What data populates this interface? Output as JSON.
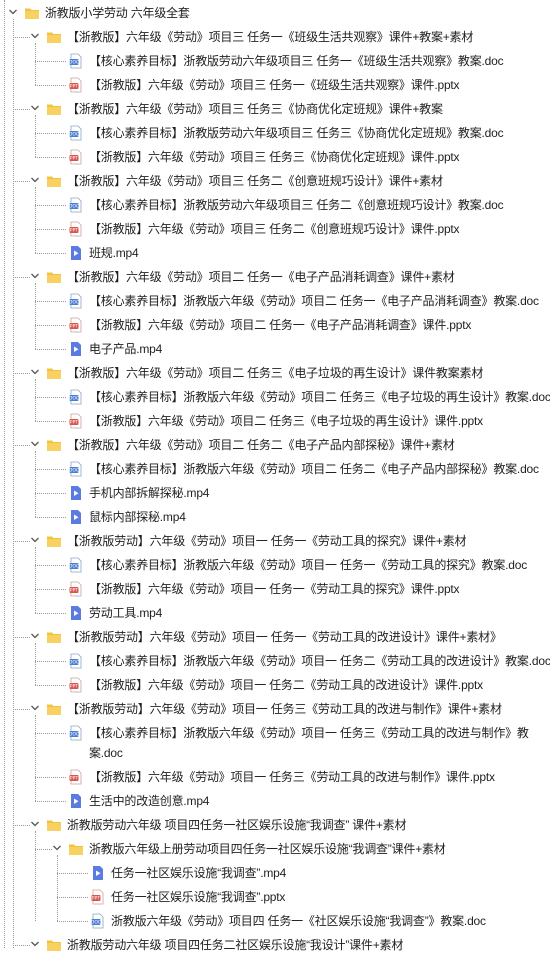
{
  "colors": {
    "folder": "#f2c23b",
    "doc": "#4a7fd1",
    "pptx": "#d9534f",
    "mp4": "#5b7be0",
    "guide": "#9a9a9a"
  },
  "tree": [
    {
      "depth": 0,
      "type": "folder",
      "expander": true,
      "label": "浙教版小学劳动 六年级全套"
    },
    {
      "depth": 1,
      "type": "folder",
      "expander": true,
      "label": "【浙教版】六年级《劳动》项目三 任务一《班级生活共观察》课件+教案+素材"
    },
    {
      "depth": 2,
      "type": "doc",
      "expander": false,
      "label": "【核心素养目标】浙教版劳动六年级项目三 任务一《班级生活共观察》教案.doc"
    },
    {
      "depth": 2,
      "type": "pptx",
      "expander": false,
      "label": "【浙教版】六年级《劳动》项目三 任务一《班级生活共观察》课件.pptx"
    },
    {
      "depth": 1,
      "type": "folder",
      "expander": true,
      "label": "【浙教版】六年级《劳动》项目三 任务三《协商优化定班规》课件+教案"
    },
    {
      "depth": 2,
      "type": "doc",
      "expander": false,
      "label": "【核心素养目标】浙教版劳动六年级项目三 任务三《协商优化定班规》教案.doc"
    },
    {
      "depth": 2,
      "type": "pptx",
      "expander": false,
      "label": "【浙教版】六年级《劳动》项目三 任务三《协商优化定班规》课件.pptx"
    },
    {
      "depth": 1,
      "type": "folder",
      "expander": true,
      "label": "【浙教版】六年级《劳动》项目三 任务二《创意班规巧设计》课件+素材"
    },
    {
      "depth": 2,
      "type": "doc",
      "expander": false,
      "label": "【核心素养目标】浙教版劳动六年级项目三 任务二《创意班规巧设计》教案.doc"
    },
    {
      "depth": 2,
      "type": "pptx",
      "expander": false,
      "label": "【浙教版】六年级《劳动》项目三 任务二《创意班规巧设计》课件.pptx"
    },
    {
      "depth": 2,
      "type": "mp4",
      "expander": false,
      "label": "班规.mp4"
    },
    {
      "depth": 1,
      "type": "folder",
      "expander": true,
      "label": "【浙教版】六年级《劳动》项目二 任务一《电子产品消耗调查》课件+素材"
    },
    {
      "depth": 2,
      "type": "doc",
      "expander": false,
      "label": "【核心素养目标】浙教版六年级《劳动》项目二 任务一《电子产品消耗调查》教案.doc"
    },
    {
      "depth": 2,
      "type": "pptx",
      "expander": false,
      "label": "【浙教版】六年级《劳动》项目二 任务一《电子产品消耗调查》课件.pptx"
    },
    {
      "depth": 2,
      "type": "mp4",
      "expander": false,
      "label": "电子产品.mp4"
    },
    {
      "depth": 1,
      "type": "folder",
      "expander": true,
      "label": "【浙教版】六年级《劳动》项目二 任务三《电子垃圾的再生设计》课件教案素材"
    },
    {
      "depth": 2,
      "type": "doc",
      "expander": false,
      "label": "【核心素养目标】浙教版六年级《劳动》项目二 任务三《电子垃圾的再生设计》教案.doc"
    },
    {
      "depth": 2,
      "type": "pptx",
      "expander": false,
      "label": "【浙教版】六年级《劳动》项目二 任务三《电子垃圾的再生设计》课件.pptx"
    },
    {
      "depth": 1,
      "type": "folder",
      "expander": true,
      "label": "【浙教版】六年级《劳动》项目二 任务二《电子产品内部探秘》课件+素材"
    },
    {
      "depth": 2,
      "type": "doc",
      "expander": false,
      "label": "【核心素养目标】浙教版六年级《劳动》项目二 任务二《电子产品内部探秘》教案.doc"
    },
    {
      "depth": 2,
      "type": "mp4",
      "expander": false,
      "label": "手机内部拆解探秘.mp4"
    },
    {
      "depth": 2,
      "type": "mp4",
      "expander": false,
      "label": "鼠标内部探秘.mp4"
    },
    {
      "depth": 1,
      "type": "folder",
      "expander": true,
      "label": "【浙教版劳动】六年级《劳动》项目一 任务一《劳动工具的探究》课件+素材"
    },
    {
      "depth": 2,
      "type": "doc",
      "expander": false,
      "label": "【核心素养目标】浙教版六年级《劳动》项目一 任务一《劳动工具的探究》教案.doc"
    },
    {
      "depth": 2,
      "type": "pptx",
      "expander": false,
      "label": "【浙教版】六年级《劳动》项目一 任务一《劳动工具的探究》课件.pptx"
    },
    {
      "depth": 2,
      "type": "mp4",
      "expander": false,
      "label": "劳动工具.mp4"
    },
    {
      "depth": 1,
      "type": "folder",
      "expander": true,
      "label": "【浙教版劳动】六年级《劳动》项目一 任务一《劳动工具的改进设计》课件+素材》"
    },
    {
      "depth": 2,
      "type": "doc",
      "expander": false,
      "label": "【核心素养目标】浙教版六年级《劳动》项目一 任务二《劳动工具的改进设计》教案.doc"
    },
    {
      "depth": 2,
      "type": "pptx",
      "expander": false,
      "label": "【浙教版】六年级《劳动》项目一 任务二《劳动工具的改进设计》课件.pptx"
    },
    {
      "depth": 1,
      "type": "folder",
      "expander": true,
      "label": "【浙教版劳动】六年级《劳动》项目一 任务三《劳动工具的改进与制作》课件+素材"
    },
    {
      "depth": 2,
      "type": "doc",
      "expander": false,
      "wrap": true,
      "label": "【核心素养目标】浙教版六年级《劳动》项目一 任务三《劳动工具的改进与制作》教案.doc"
    },
    {
      "depth": 2,
      "type": "pptx",
      "expander": false,
      "label": "【浙教版】六年级《劳动》项目一 任务三《劳动工具的改进与制作》课件.pptx"
    },
    {
      "depth": 2,
      "type": "mp4",
      "expander": false,
      "label": "生活中的改造创意.mp4"
    },
    {
      "depth": 1,
      "type": "folder",
      "expander": true,
      "label": "浙教版劳动六年级 项目四任务一社区娱乐设施“我调查” 课件+素材"
    },
    {
      "depth": 2,
      "type": "folder",
      "expander": true,
      "label": "浙教版六年级上册劳动项目四任务一社区娱乐设施“我调查”课件+素材"
    },
    {
      "depth": 3,
      "type": "mp4",
      "expander": false,
      "label": "任务一社区娱乐设施“我调查”.mp4"
    },
    {
      "depth": 3,
      "type": "pptx",
      "expander": false,
      "label": "任务一社区娱乐设施“我调查”.pptx"
    },
    {
      "depth": 3,
      "type": "doc",
      "expander": false,
      "label": "浙教版六年级《劳动》项目四 任务一《社区娱乐设施“我调查”》教案.doc"
    },
    {
      "depth": 1,
      "type": "folder",
      "expander": true,
      "label": "浙教版劳动六年级 项目四任务二社区娱乐设施“我设计”课件+素材"
    }
  ]
}
